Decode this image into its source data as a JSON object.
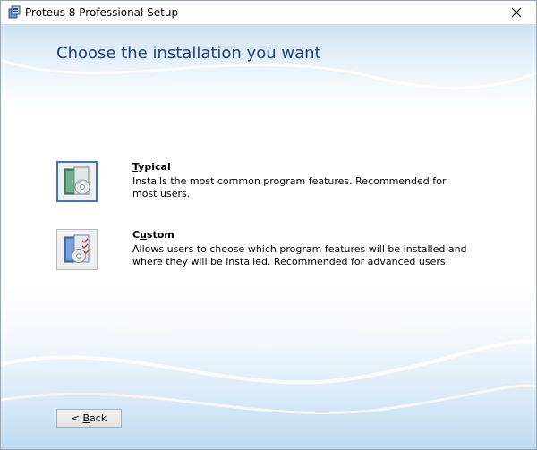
{
  "window": {
    "title": "Proteus 8 Professional Setup"
  },
  "page": {
    "title": "Choose the installation you want"
  },
  "options": [
    {
      "accel": "T",
      "label_rest": "ypical",
      "description": "Installs the most common program features. Recommended for most users.",
      "icon": "typical-install-icon"
    },
    {
      "accel": "u",
      "label_prefix": "C",
      "label_rest": "stom",
      "description": "Allows users to choose which program features will be installed and where they will be installed. Recommended for advanced users.",
      "icon": "custom-install-icon"
    }
  ],
  "buttons": {
    "back_prefix": "< ",
    "back_accel": "B",
    "back_rest": "ack"
  },
  "colors": {
    "title": "#1e3c84",
    "focus_border": "#3c74c8",
    "background_wave": "#cfe4f4"
  }
}
